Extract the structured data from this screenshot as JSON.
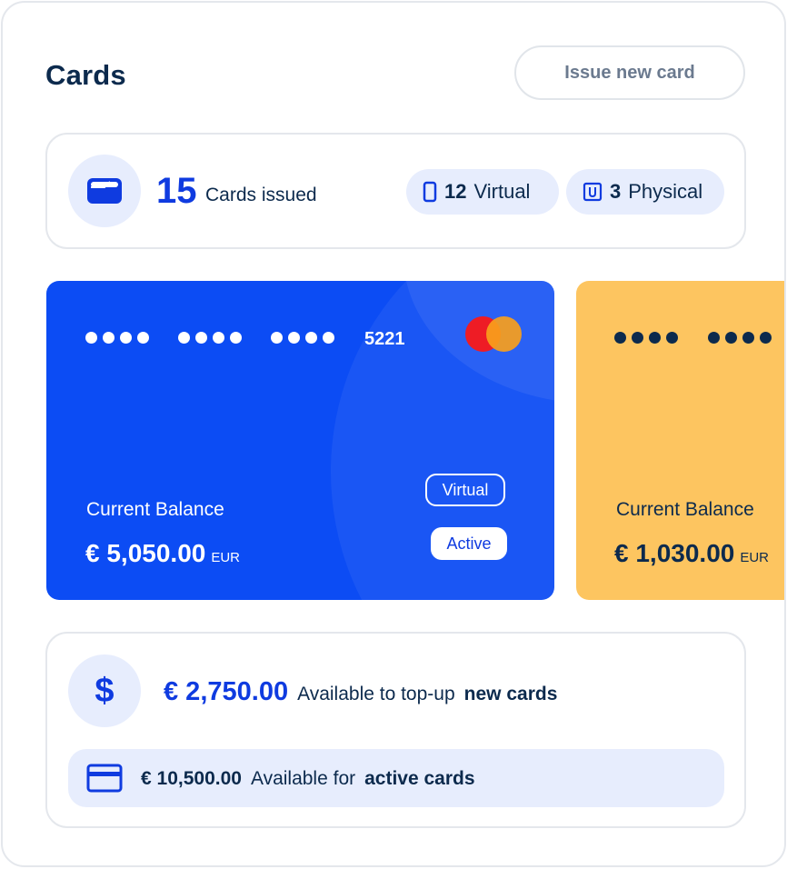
{
  "header": {
    "title": "Cards",
    "issue_button_label": "Issue new card"
  },
  "summary": {
    "issued_count": "15",
    "issued_label": "Cards issued",
    "virtual_count": "12",
    "virtual_label": "Virtual",
    "physical_count": "3",
    "physical_label": "Physical"
  },
  "cards": [
    {
      "last4": "5221",
      "balance_label": "Current Balance",
      "balance": "€ 5,050.00",
      "currency": "EUR",
      "type_tag": "Virtual",
      "status_tag": "Active",
      "color": "#0c4cf4",
      "brand_icon": "mastercard-logo"
    },
    {
      "balance_label": "Current Balance",
      "balance": "€ 1,030.00",
      "currency": "EUR",
      "color": "#fdc560"
    }
  ],
  "funds": {
    "topup_amount": "€ 2,750.00",
    "topup_text": "Available to top-up",
    "topup_bold": "new cards",
    "active_amount": "€ 10,500.00",
    "active_text": "Available for",
    "active_bold": "active cards"
  },
  "colors": {
    "accent": "#0f3be0",
    "navy": "#0c2a4d",
    "soft_blue": "#e7edfd",
    "card_yellow": "#fdc560"
  }
}
